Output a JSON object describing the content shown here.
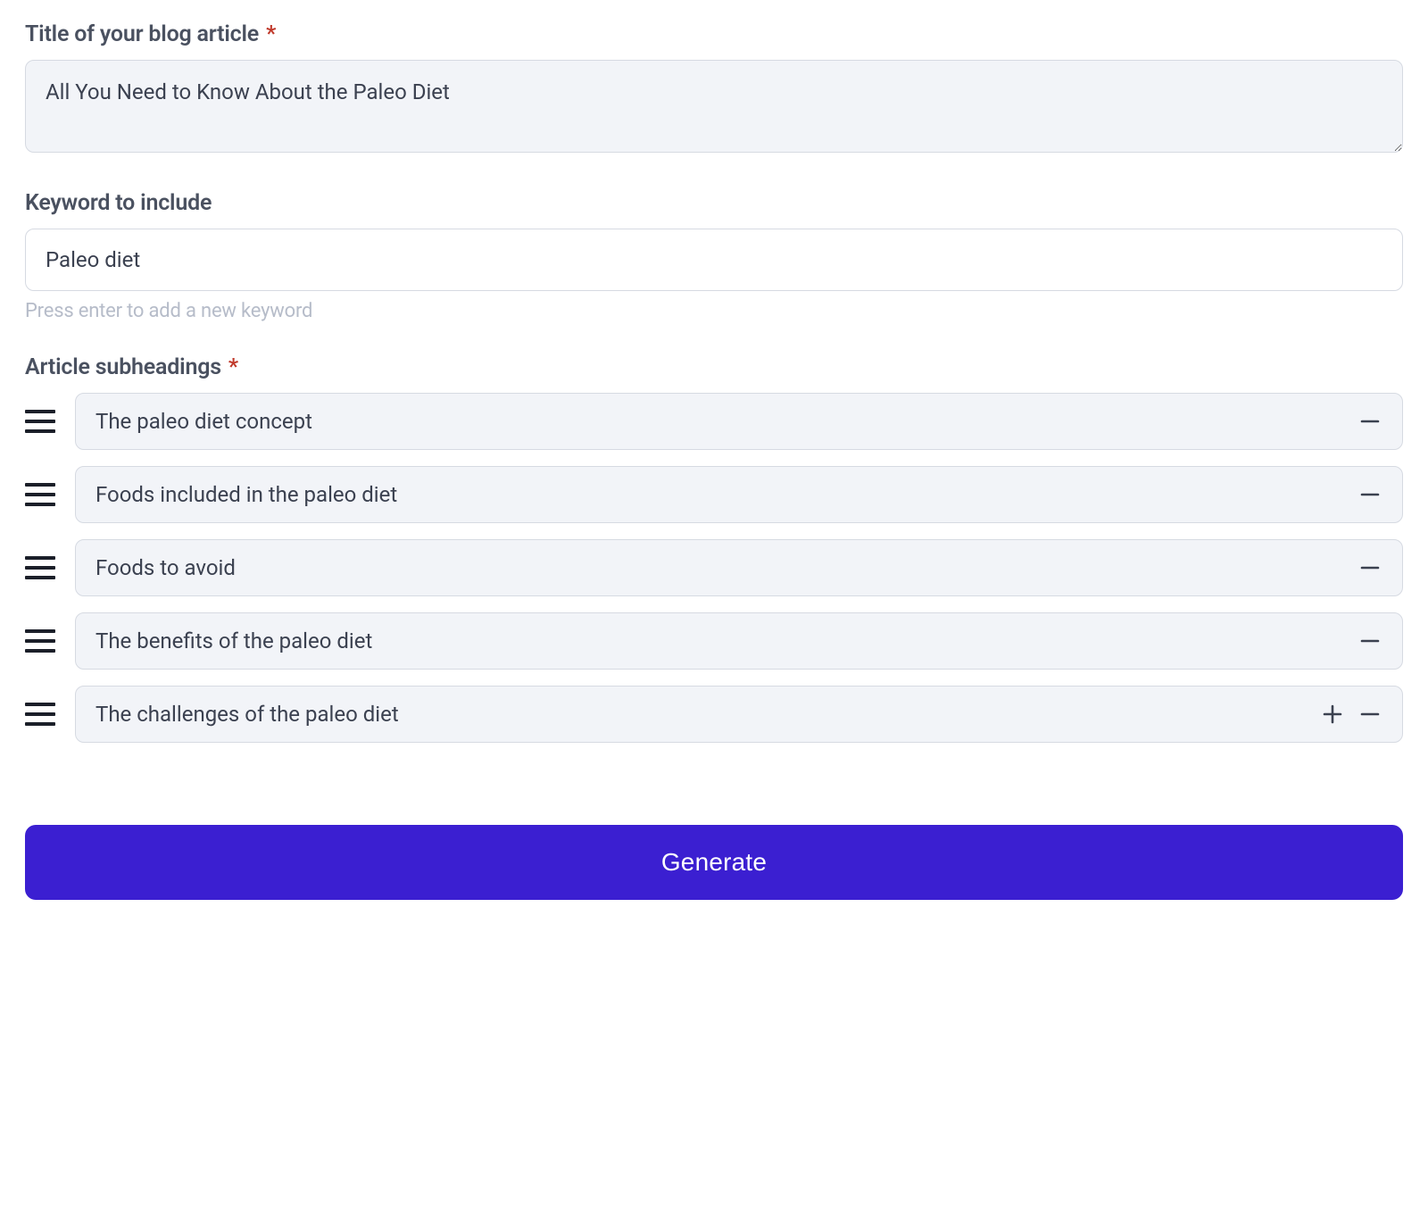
{
  "title_field": {
    "label": "Title of your blog article",
    "required": true,
    "value": "All You Need to Know About the Paleo Diet"
  },
  "keyword_field": {
    "label": "Keyword to include",
    "value": "Paleo diet",
    "helper": "Press enter to add a new keyword"
  },
  "subheadings_field": {
    "label": "Article subheadings",
    "required": true,
    "items": [
      {
        "text": "The paleo diet concept",
        "show_add": false
      },
      {
        "text": "Foods included in the paleo diet",
        "show_add": false
      },
      {
        "text": "Foods to avoid",
        "show_add": false
      },
      {
        "text": "The benefits of the paleo diet",
        "show_add": false
      },
      {
        "text": "The challenges of the paleo diet",
        "show_add": true
      }
    ]
  },
  "generate_button": {
    "label": "Generate"
  },
  "colors": {
    "accent": "#3b1fd1",
    "panel": "#f2f4f8",
    "border": "#d6dae2"
  }
}
